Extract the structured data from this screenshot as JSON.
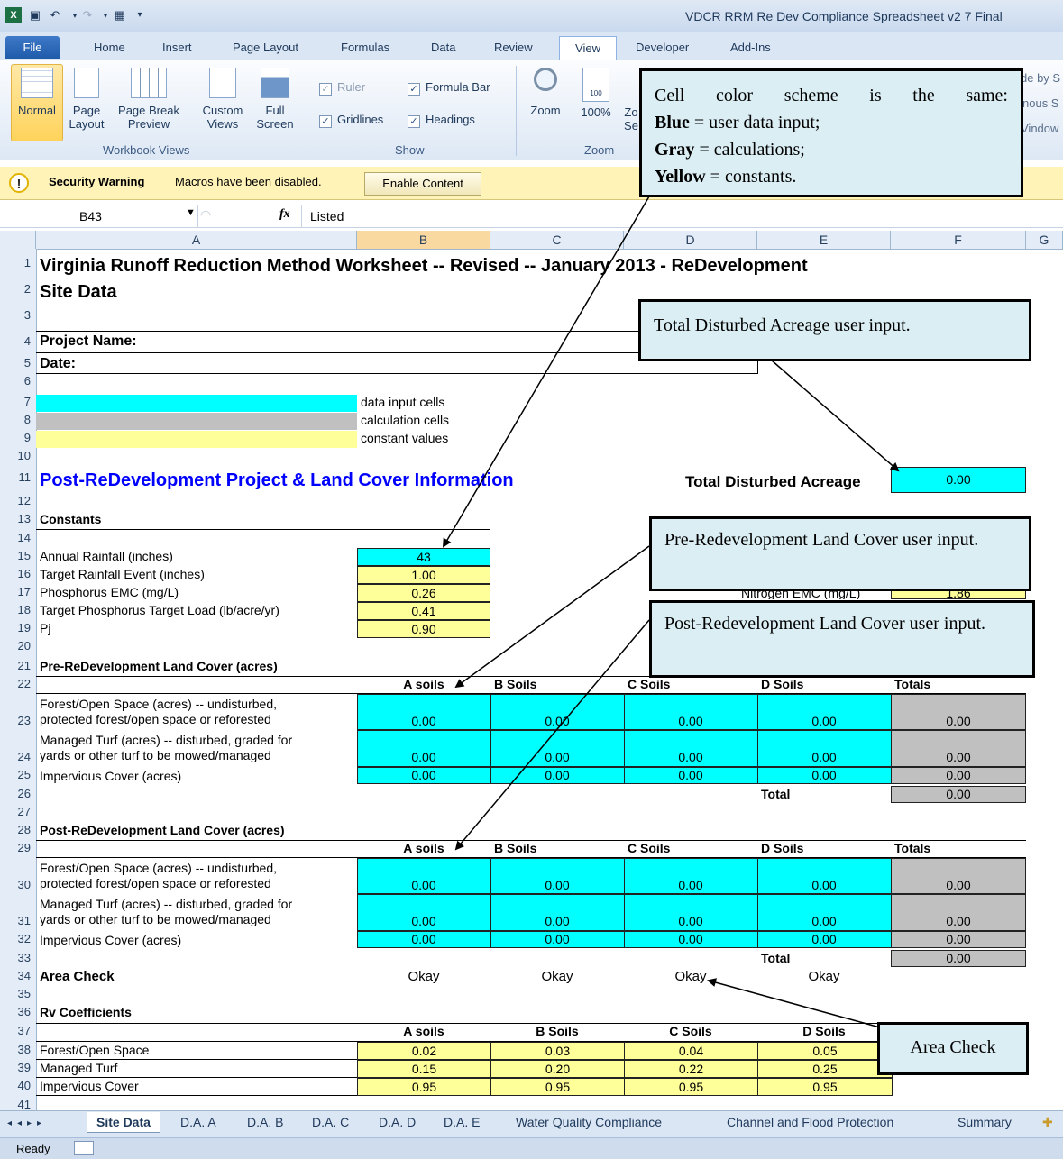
{
  "window": {
    "title": "VDCR RRM Re Dev Compliance Spreadsheet v2 7 Final"
  },
  "ribbon": {
    "tabs": [
      "File",
      "Home",
      "Insert",
      "Page Layout",
      "Formulas",
      "Data",
      "Review",
      "View",
      "Developer",
      "Add-Ins"
    ],
    "active_tab": "View",
    "workbook_views": {
      "normal": "Normal",
      "page_layout_1": "Page",
      "page_layout_2": "Layout",
      "page_break_1": "Page Break",
      "page_break_2": "Preview",
      "custom_1": "Custom",
      "custom_2": "Views",
      "full_1": "Full",
      "full_2": "Screen",
      "group": "Workbook Views"
    },
    "show": {
      "ruler": "Ruler",
      "formula_bar": "Formula Bar",
      "gridlines": "Gridlines",
      "headings": "Headings",
      "group": "Show"
    },
    "zoom": {
      "zoom": "Zoom",
      "hundred": "100%",
      "zoom_to_sel_1": "Zo",
      "zoom_to_sel_2": "Se",
      "group": "Zoom",
      "hundred_icon_text": "100"
    },
    "window_partial": {
      "line1": "de by S",
      "line2": "nous S",
      "line3": "Vindow"
    }
  },
  "security": {
    "label": "Security Warning",
    "message": "Macros have been disabled.",
    "button": "Enable Content"
  },
  "formula_bar": {
    "name_box": "B43",
    "fx": "fx",
    "value": "Listed"
  },
  "columns": [
    "A",
    "B",
    "C",
    "D",
    "E",
    "F",
    "G"
  ],
  "rows": [
    "1",
    "2",
    "3",
    "4",
    "5",
    "6",
    "7",
    "8",
    "9",
    "10",
    "11",
    "12",
    "13",
    "14",
    "15",
    "16",
    "17",
    "18",
    "19",
    "20",
    "21",
    "22",
    "23",
    "24",
    "25",
    "26",
    "27",
    "28",
    "29",
    "30",
    "31",
    "32",
    "33",
    "34",
    "35",
    "36",
    "37",
    "38",
    "39",
    "40",
    "41"
  ],
  "sheet": {
    "title": "Virginia Runoff Reduction Method Worksheet -- Revised -- January 2013 - ReDevelopment",
    "subtitle": "Site Data",
    "project_name": "Project Name:",
    "date": "Date:",
    "legend": {
      "input": "data input cells",
      "calc": "calculation cells",
      "const": "constant values"
    },
    "section_post_info": "Post-ReDevelopment Project & Land Cover Information",
    "total_disturbed_label": "Total Disturbed Acreage",
    "total_disturbed_value": "0.00",
    "constants_header": "Constants",
    "constants": [
      {
        "label": "Annual Rainfall (inches)",
        "value": "43"
      },
      {
        "label": "Target Rainfall Event (inches)",
        "value": "1.00"
      },
      {
        "label": "Phosphorus EMC (mg/L)",
        "value": "0.26"
      },
      {
        "label": "Target Phosphorus Target Load (lb/acre/yr)",
        "value": "0.41"
      },
      {
        "label": "Pj",
        "value": "0.90"
      }
    ],
    "nitrogen_emc_label": "Nitrogen EMC (mg/L)",
    "nitrogen_emc_value": "1.86",
    "pre_header": "Pre-ReDevelopment Land Cover  (acres)",
    "post_header": "Post-ReDevelopment Land Cover  (acres)",
    "soil_headers_lc": [
      "A soils",
      "B Soils",
      "C Soils",
      "D Soils",
      "Totals"
    ],
    "cover_rows": [
      {
        "line1": "Forest/Open Space (acres) -- undisturbed,",
        "line2": "protected forest/open space or reforested"
      },
      {
        "line1": "Managed Turf (acres) -- disturbed, graded for",
        "line2": "yards or other turf to be mowed/managed"
      },
      {
        "line1": "Impervious Cover (acres)",
        "line2": ""
      }
    ],
    "zero": "0.00",
    "total_label": "Total",
    "area_check_label": "Area Check",
    "area_check_values": [
      "Okay",
      "Okay",
      "Okay",
      "Okay"
    ],
    "rv_header": "Rv Coefficients",
    "rv_col_headers": [
      "A soils",
      "B Soils",
      "C Soils",
      "D Soils"
    ],
    "rv_rows": [
      {
        "label": "Forest/Open Space",
        "values": [
          "0.02",
          "0.03",
          "0.04",
          "0.05"
        ]
      },
      {
        "label": "Managed Turf",
        "values": [
          "0.15",
          "0.20",
          "0.22",
          "0.25"
        ]
      },
      {
        "label": "Impervious Cover",
        "values": [
          "0.95",
          "0.95",
          "0.95",
          "0.95"
        ]
      }
    ]
  },
  "callouts": {
    "color_scheme": {
      "line1": "Cell color scheme is the same:",
      "blue_b": "Blue",
      "blue_t": " = user data input;",
      "gray_b": "Gray",
      "gray_t": " = calculations;",
      "yellow_b": "Yellow",
      "yellow_t": " = constants."
    },
    "total_disturbed": "Total Disturbed Acreage user input.",
    "pre_redev": "Pre-Redevelopment Land Cover user input.",
    "post_redev": "Post-Redevelopment Land Cover user input.",
    "area_check": "Area Check"
  },
  "sheet_tabs": [
    "Site Data",
    "D.A. A",
    "D.A. B",
    "D.A. C",
    "D.A. D",
    "D.A. E",
    "Water Quality Compliance",
    "Channel and Flood Protection",
    "Summary"
  ],
  "status": {
    "ready": "Ready"
  },
  "colors": {
    "input": "#00ffff",
    "calc": "#c0c0c0",
    "const": "#ffff99",
    "callout": "#dbeef4"
  }
}
